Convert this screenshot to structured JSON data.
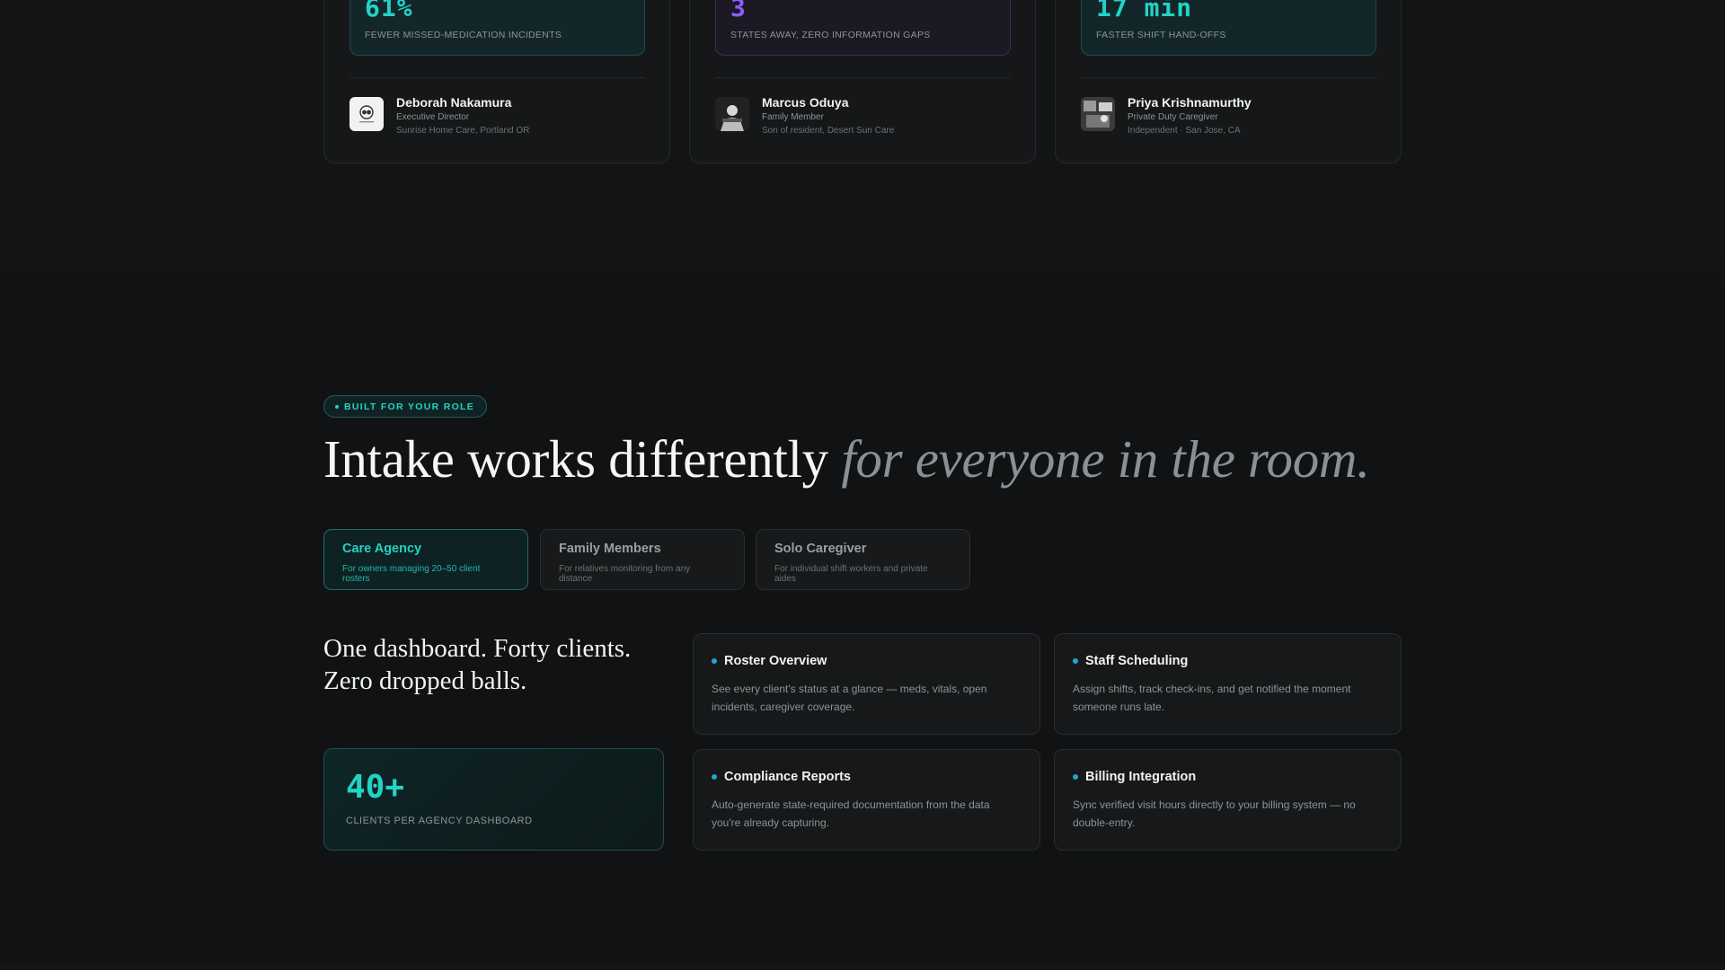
{
  "testimonials": [
    {
      "stat": "61%",
      "stat_label": "FEWER MISSED-MEDICATION INCIDENTS",
      "name": "Deborah Nakamura",
      "role": "Executive Director",
      "org": "Sunrise Home Care, Portland OR",
      "accent": "#22d3c5"
    },
    {
      "stat": "3",
      "stat_label": "STATES AWAY, ZERO INFORMATION GAPS",
      "name": "Marcus Oduya",
      "role": "Family Member",
      "org": "Son of resident, Desert Sun Care",
      "accent": "#8b5cf6"
    },
    {
      "stat": "17 min",
      "stat_label": "FASTER SHIFT HAND-OFFS",
      "name": "Priya Krishnamurthy",
      "role": "Private Duty Caregiver",
      "org": "Independent · San Jose, CA",
      "accent": "#22d3c5"
    }
  ],
  "section": {
    "badge": "BUILT FOR YOUR ROLE",
    "heading_main": "Intake works differently",
    "heading_italic": "for everyone in the room."
  },
  "tabs": [
    {
      "title": "Care Agency",
      "subtitle": "For owners managing 20–50 client rosters",
      "active": true
    },
    {
      "title": "Family Members",
      "subtitle": "For relatives monitoring from any distance",
      "active": false
    },
    {
      "title": "Solo Caregiver",
      "subtitle": "For individual shift workers and private aides",
      "active": false
    }
  ],
  "panel": {
    "lead_line1": "One dashboard. Forty clients.",
    "lead_line2": "Zero dropped balls.",
    "stat_value": "40+",
    "stat_label": "CLIENTS PER AGENCY DASHBOARD",
    "features": [
      {
        "title": "Roster Overview",
        "description": "See every client's status at a glance — meds, vitals, open incidents, caregiver coverage."
      },
      {
        "title": "Staff Scheduling",
        "description": "Assign shifts, track check-ins, and get notified the moment someone runs late."
      },
      {
        "title": "Compliance Reports",
        "description": "Auto-generate state-required documentation from the data you're already capturing."
      },
      {
        "title": "Billing Integration",
        "description": "Sync verified visit hours directly to your billing system — no double-entry."
      }
    ]
  },
  "colors": {
    "accent_teal": "#22d3c5",
    "accent_purple": "#8b5cf6",
    "background": "#101213"
  }
}
